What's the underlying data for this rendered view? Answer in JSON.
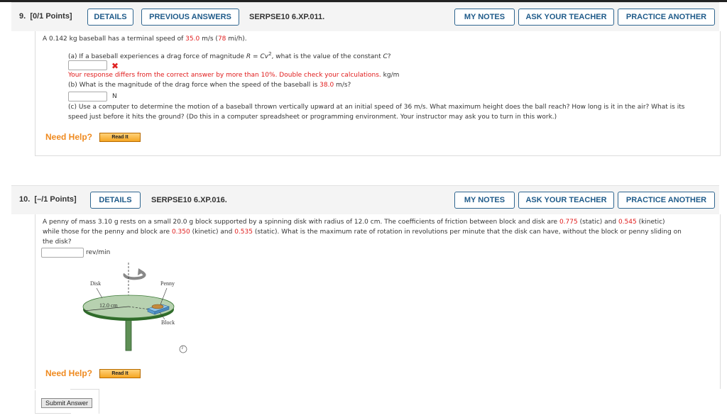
{
  "questions": [
    {
      "number": "9.",
      "points": "[0/1 Points]",
      "buttons": {
        "details": "DETAILS",
        "previous_answers": "PREVIOUS ANSWERS",
        "my_notes": "MY NOTES",
        "ask_teacher": "ASK YOUR TEACHER",
        "practice_another": "PRACTICE ANOTHER"
      },
      "code": "SERPSE10 6.XP.011.",
      "intro": {
        "p1": "A 0.142 kg baseball has a terminal speed of ",
        "v1": "35.0",
        "p2": " m/s (",
        "v2": "78",
        "p3": " mi/h)."
      },
      "part_a": {
        "prefix": "(a) If a baseball experiences a drag force of magnitude ",
        "formula": "R = Cv",
        "exp": "2",
        "suffix": ", what is the value of the constant ",
        "const": "C",
        "q": "?",
        "answer_value": "",
        "status_icon": "✖",
        "feedback": "Your response differs from the correct answer by more than 10%. Double check your calculations.",
        "unit": "kg/m"
      },
      "part_b": {
        "prefix": "(b) What is the magnitude of the drag force when the speed of the baseball is ",
        "value": "38.0",
        "suffix": " m/s?",
        "answer_value": "",
        "unit": "N"
      },
      "part_c": {
        "line1": "(c) Use a computer to determine the motion of a baseball thrown vertically upward at an initial speed of 36 m/s. What maximum height does the ball reach? How long is it in the air? What is its",
        "line2": "speed just before it hits the ground? (Do this in a computer spreadsheet or programming environment. Your instructor may ask you to turn in this work.)"
      },
      "need_help": "Need Help?",
      "read_it": "Read It"
    },
    {
      "number": "10.",
      "points": "[–/1 Points]",
      "buttons": {
        "details": "DETAILS",
        "my_notes": "MY NOTES",
        "ask_teacher": "ASK YOUR TEACHER",
        "practice_another": "PRACTICE ANOTHER"
      },
      "code": "SERPSE10 6.XP.016.",
      "text": {
        "l1a": "A penny of mass 3.10 g rests on a small 20.0 g block supported by a spinning disk with radius of 12.0 cm. The coefficients of friction between block and disk are ",
        "v1": "0.775",
        "l1b": " (static) and ",
        "v2": "0.545",
        "l1c": " (kinetic)",
        "l2a": "while those for the penny and block are ",
        "v3": "0.350",
        "l2b": " (kinetic) and ",
        "v4": "0.535",
        "l2c": " (static). What is the maximum rate of rotation in revolutions per minute that the disk can have, without the block or penny sliding on",
        "l3": "the disk?"
      },
      "answer_value": "",
      "unit": "rev/min",
      "figure": {
        "disk_label": "Disk",
        "penny_label": "Penny",
        "radius_label": "12.0 cm",
        "block_label": "Block",
        "info_icon": "i"
      },
      "need_help": "Need Help?",
      "read_it": "Read It",
      "submit": "Submit Answer"
    }
  ],
  "colors": {
    "accent_blue": "#1f5b8a",
    "value_red": "#e01b1b",
    "help_orange": "#ef8a1f"
  }
}
